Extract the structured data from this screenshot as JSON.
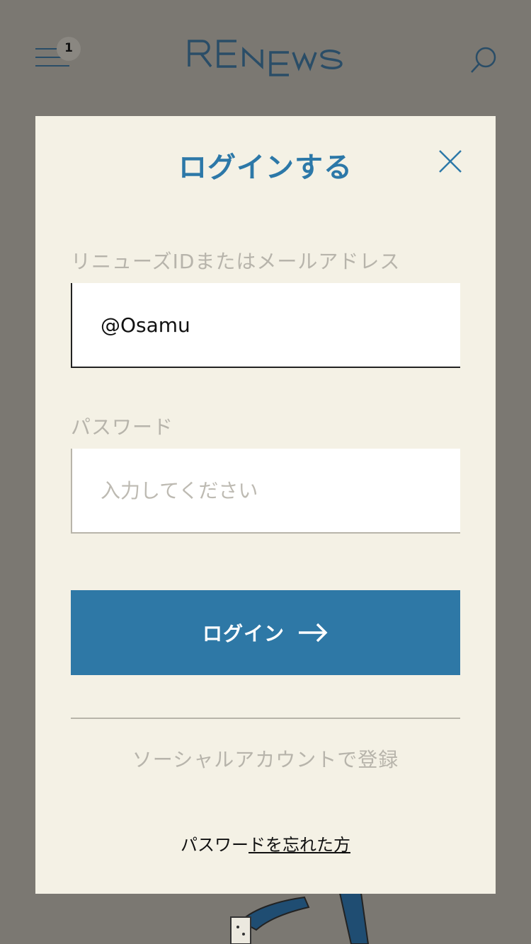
{
  "header": {
    "notification_count": "1",
    "logo_text": "RENEWS",
    "colors": {
      "brand": "#2a4d67"
    }
  },
  "modal": {
    "title": "ログインする",
    "id_field": {
      "label": "リニューズIDまたはメールアドレス",
      "value": "@Osamu"
    },
    "password_field": {
      "label": "パスワード",
      "placeholder": "入力してください",
      "value": ""
    },
    "login_button": {
      "label": "ログイン"
    },
    "social_label": "ソーシャルアカウントで登録",
    "forgot": {
      "prefix": "パスワー",
      "link": "ドを忘れた方"
    },
    "colors": {
      "accent": "#2e78a6",
      "background": "#f4f1e5"
    }
  },
  "icons": [
    "menu-icon",
    "search-icon",
    "close-icon",
    "arrow-right-icon"
  ]
}
